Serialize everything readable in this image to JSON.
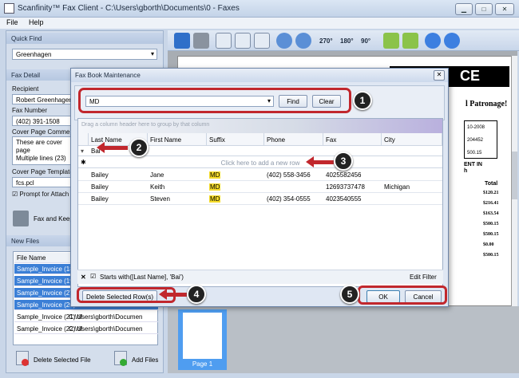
{
  "window": {
    "title": "Scanfinity™ Fax Client - C:\\Users\\gborth\\Documents\\0 - Faxes",
    "min": "▁",
    "max": "□",
    "close": "✕"
  },
  "menu": [
    "File",
    "Help"
  ],
  "left": {
    "quick_find_label": "Quick Find",
    "quick_find_value": "Greenhagen",
    "fax_detail_label": "Fax Detail",
    "recipient_label": "Recipient",
    "recipient_value": "Robert Greenhagen, I",
    "fax_number_label": "Fax Number",
    "fax_number_value": "(402) 391-1508",
    "cover_comments_label": "Cover Page Comments",
    "cover_comments_value": [
      "These are cover page",
      "",
      "Multiple lines (23) are"
    ],
    "cover_template_label": "Cover Page Template",
    "cover_template_value": "fcs.pcl",
    "prompt_label": "Prompt for Attach",
    "fax_keep_label": "Fax and Keep",
    "new_files_label": "New Files",
    "file_name_header": "File Name",
    "files": [
      "Sample_Invoice (18).t",
      "Sample_Invoice (19).t",
      "Sample_Invoice (2).tif",
      "Sample_Invoice (20).t",
      "Sample_Invoice (21).tif",
      "Sample_Invoice (22).tif"
    ],
    "file_paths": [
      "",
      "",
      "",
      "",
      "C:\\Users\\gborth\\Documen",
      "C:\\Users\\gborth\\Documen"
    ],
    "delete_label": "Delete Selected File",
    "add_label": "Add Files"
  },
  "toolbar": {
    "rotate": [
      "270°",
      "180°",
      "90°"
    ]
  },
  "doc": {
    "title_frag": "CE",
    "patronage": "l Patronage!",
    "box_rows": [
      "10-2008",
      "204452",
      "500.15"
    ],
    "ent_in": [
      "ENT IN",
      "h"
    ],
    "total_label": "Total",
    "totals": [
      "$120.21",
      "$216.41",
      "$163.54",
      "$500.15",
      "$500.15",
      "$0.00",
      "$500.15"
    ]
  },
  "thumb_label": "Page 1",
  "dialog": {
    "title": "Fax Book Maintenance",
    "search_value": "MD",
    "find_label": "Find",
    "clear_label": "Clear",
    "group_hint": "Drag a column header here to group by that column",
    "columns": [
      "Last Name",
      "First Name",
      "Suffix",
      "Phone",
      "Fax",
      "City"
    ],
    "filter_value": "Bai",
    "new_row_hint": "Click here to add a new row",
    "rows": [
      [
        "Bailey",
        "Jane",
        "MD",
        "(402) 558-3456",
        "4025582456",
        ""
      ],
      [
        "Bailey",
        "Keith",
        "MD",
        "",
        "12693737478",
        "Michigan"
      ],
      [
        "Bailey",
        "Steven",
        "MD",
        "(402) 354-0555",
        "4023540555",
        ""
      ]
    ],
    "filter_text": "Starts with([Last Name], 'Bai')",
    "edit_filter": "Edit Filter",
    "delete_rows_label": "Delete Selected Row(s)",
    "ok_label": "OK",
    "cancel_label": "Cancel"
  },
  "callouts": [
    "1",
    "2",
    "3",
    "4",
    "5"
  ]
}
